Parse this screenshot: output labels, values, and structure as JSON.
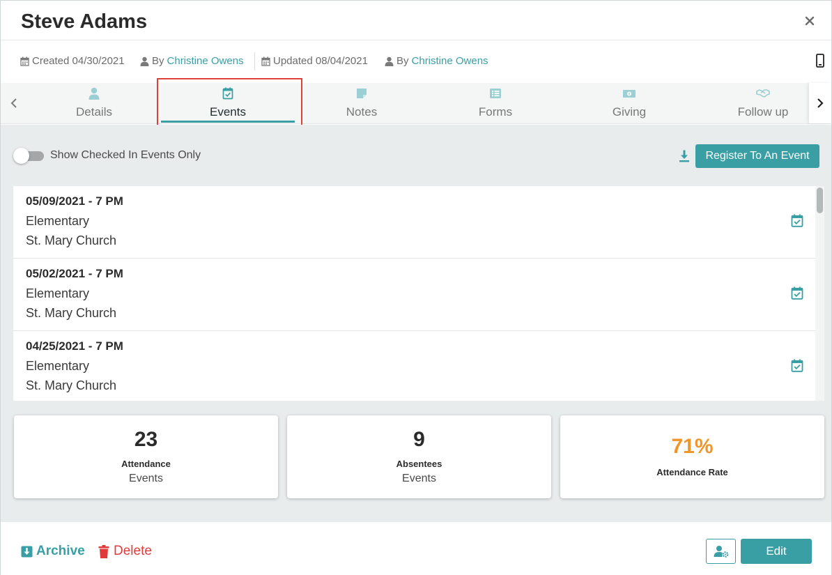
{
  "header": {
    "title": "Steve Adams"
  },
  "meta": {
    "created_label": "Created 04/30/2021",
    "created_by_prefix": "By",
    "created_by": "Christine Owens",
    "updated_label": "Updated 08/04/2021",
    "updated_by_prefix": "By",
    "updated_by": "Christine Owens"
  },
  "tabs": [
    {
      "label": "Details",
      "icon": "person-icon"
    },
    {
      "label": "Events",
      "icon": "calendar-check-icon",
      "active": true
    },
    {
      "label": "Notes",
      "icon": "note-icon"
    },
    {
      "label": "Forms",
      "icon": "list-icon"
    },
    {
      "label": "Giving",
      "icon": "money-icon"
    },
    {
      "label": "Follow up",
      "icon": "handshake-icon"
    }
  ],
  "toolbar": {
    "toggle_label": "Show Checked In Events Only",
    "toggle_on": false,
    "register_label": "Register To An Event"
  },
  "events": [
    {
      "date": "05/09/2021 - 7 PM",
      "group": "Elementary",
      "place": "St. Mary Church"
    },
    {
      "date": "05/02/2021 - 7 PM",
      "group": "Elementary",
      "place": "St. Mary Church"
    },
    {
      "date": "04/25/2021 - 7 PM",
      "group": "Elementary",
      "place": "St. Mary Church"
    }
  ],
  "stats": {
    "attendance": {
      "value": "23",
      "label": "Attendance",
      "sub": "Events"
    },
    "absentees": {
      "value": "9",
      "label": "Absentees",
      "sub": "Events"
    },
    "rate": {
      "value": "71%",
      "label": "Attendance Rate"
    }
  },
  "footer": {
    "archive_label": "Archive",
    "delete_label": "Delete",
    "edit_label": "Edit"
  },
  "colors": {
    "accent": "#3a9ea5",
    "danger": "#e03a3a",
    "rate": "#f0952a",
    "highlight": "#e0403a"
  }
}
